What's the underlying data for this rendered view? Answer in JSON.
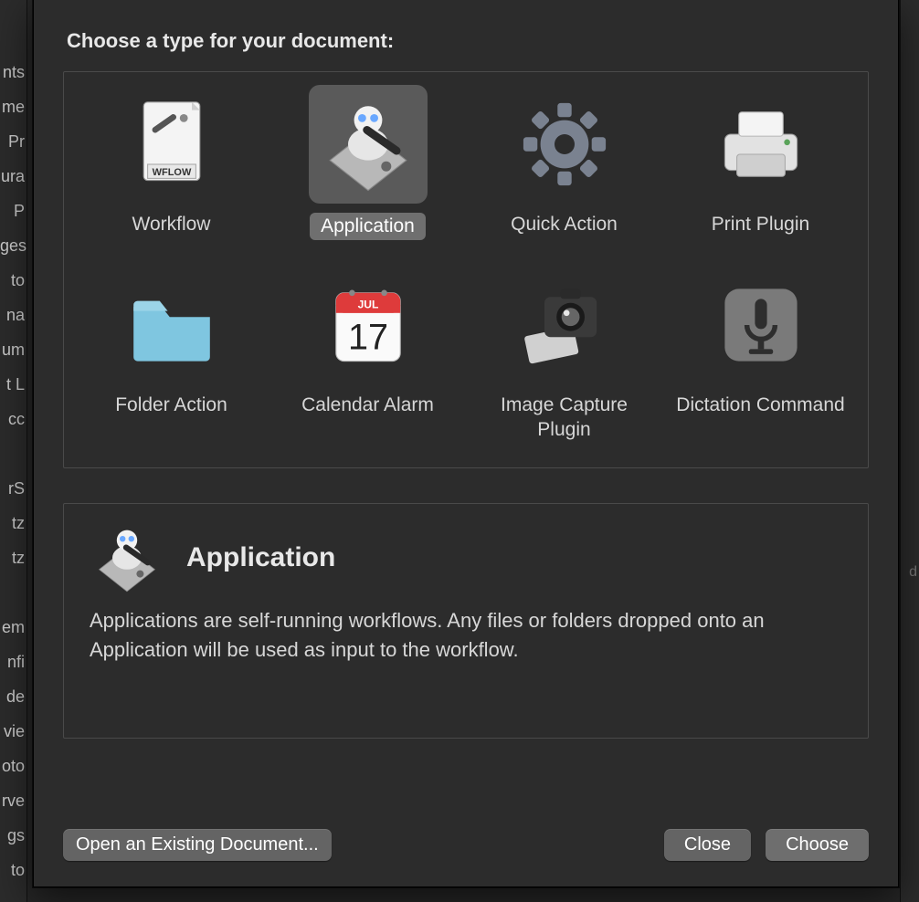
{
  "sidebar_fragments": [
    "nts",
    "me",
    "Pr",
    "ura",
    "P",
    "ges",
    "to",
    "na",
    "um",
    "t L",
    "cc",
    "",
    "rS",
    "tz",
    "tz",
    "",
    "em",
    "nfi",
    "de",
    "vie",
    "oto",
    "rve",
    "gs",
    "to"
  ],
  "right_fragment": "d",
  "dialog": {
    "prompt": "Choose a type for your document:",
    "types": [
      {
        "id": "workflow",
        "label": "Workflow",
        "icon": "workflow-icon",
        "selected": false
      },
      {
        "id": "application",
        "label": "Application",
        "icon": "automator-icon",
        "selected": true
      },
      {
        "id": "quick-action",
        "label": "Quick Action",
        "icon": "gear-icon",
        "selected": false
      },
      {
        "id": "print-plugin",
        "label": "Print Plugin",
        "icon": "printer-icon",
        "selected": false
      },
      {
        "id": "folder-action",
        "label": "Folder Action",
        "icon": "folder-icon",
        "selected": false
      },
      {
        "id": "calendar-alarm",
        "label": "Calendar Alarm",
        "icon": "calendar-icon",
        "selected": false,
        "calendar_month": "JUL",
        "calendar_day": "17"
      },
      {
        "id": "image-capture",
        "label": "Image Capture Plugin",
        "icon": "camera-icon",
        "selected": false
      },
      {
        "id": "dictation",
        "label": "Dictation Command",
        "icon": "microphone-icon",
        "selected": false
      }
    ],
    "selected": {
      "title": "Application",
      "description": "Applications are self-running workflows. Any files or folders dropped onto an Application will be used as input to the workflow.",
      "icon": "automator-icon"
    },
    "buttons": {
      "open_existing": "Open an Existing Document...",
      "close": "Close",
      "choose": "Choose"
    },
    "workflow_badge": "WFLOW"
  }
}
